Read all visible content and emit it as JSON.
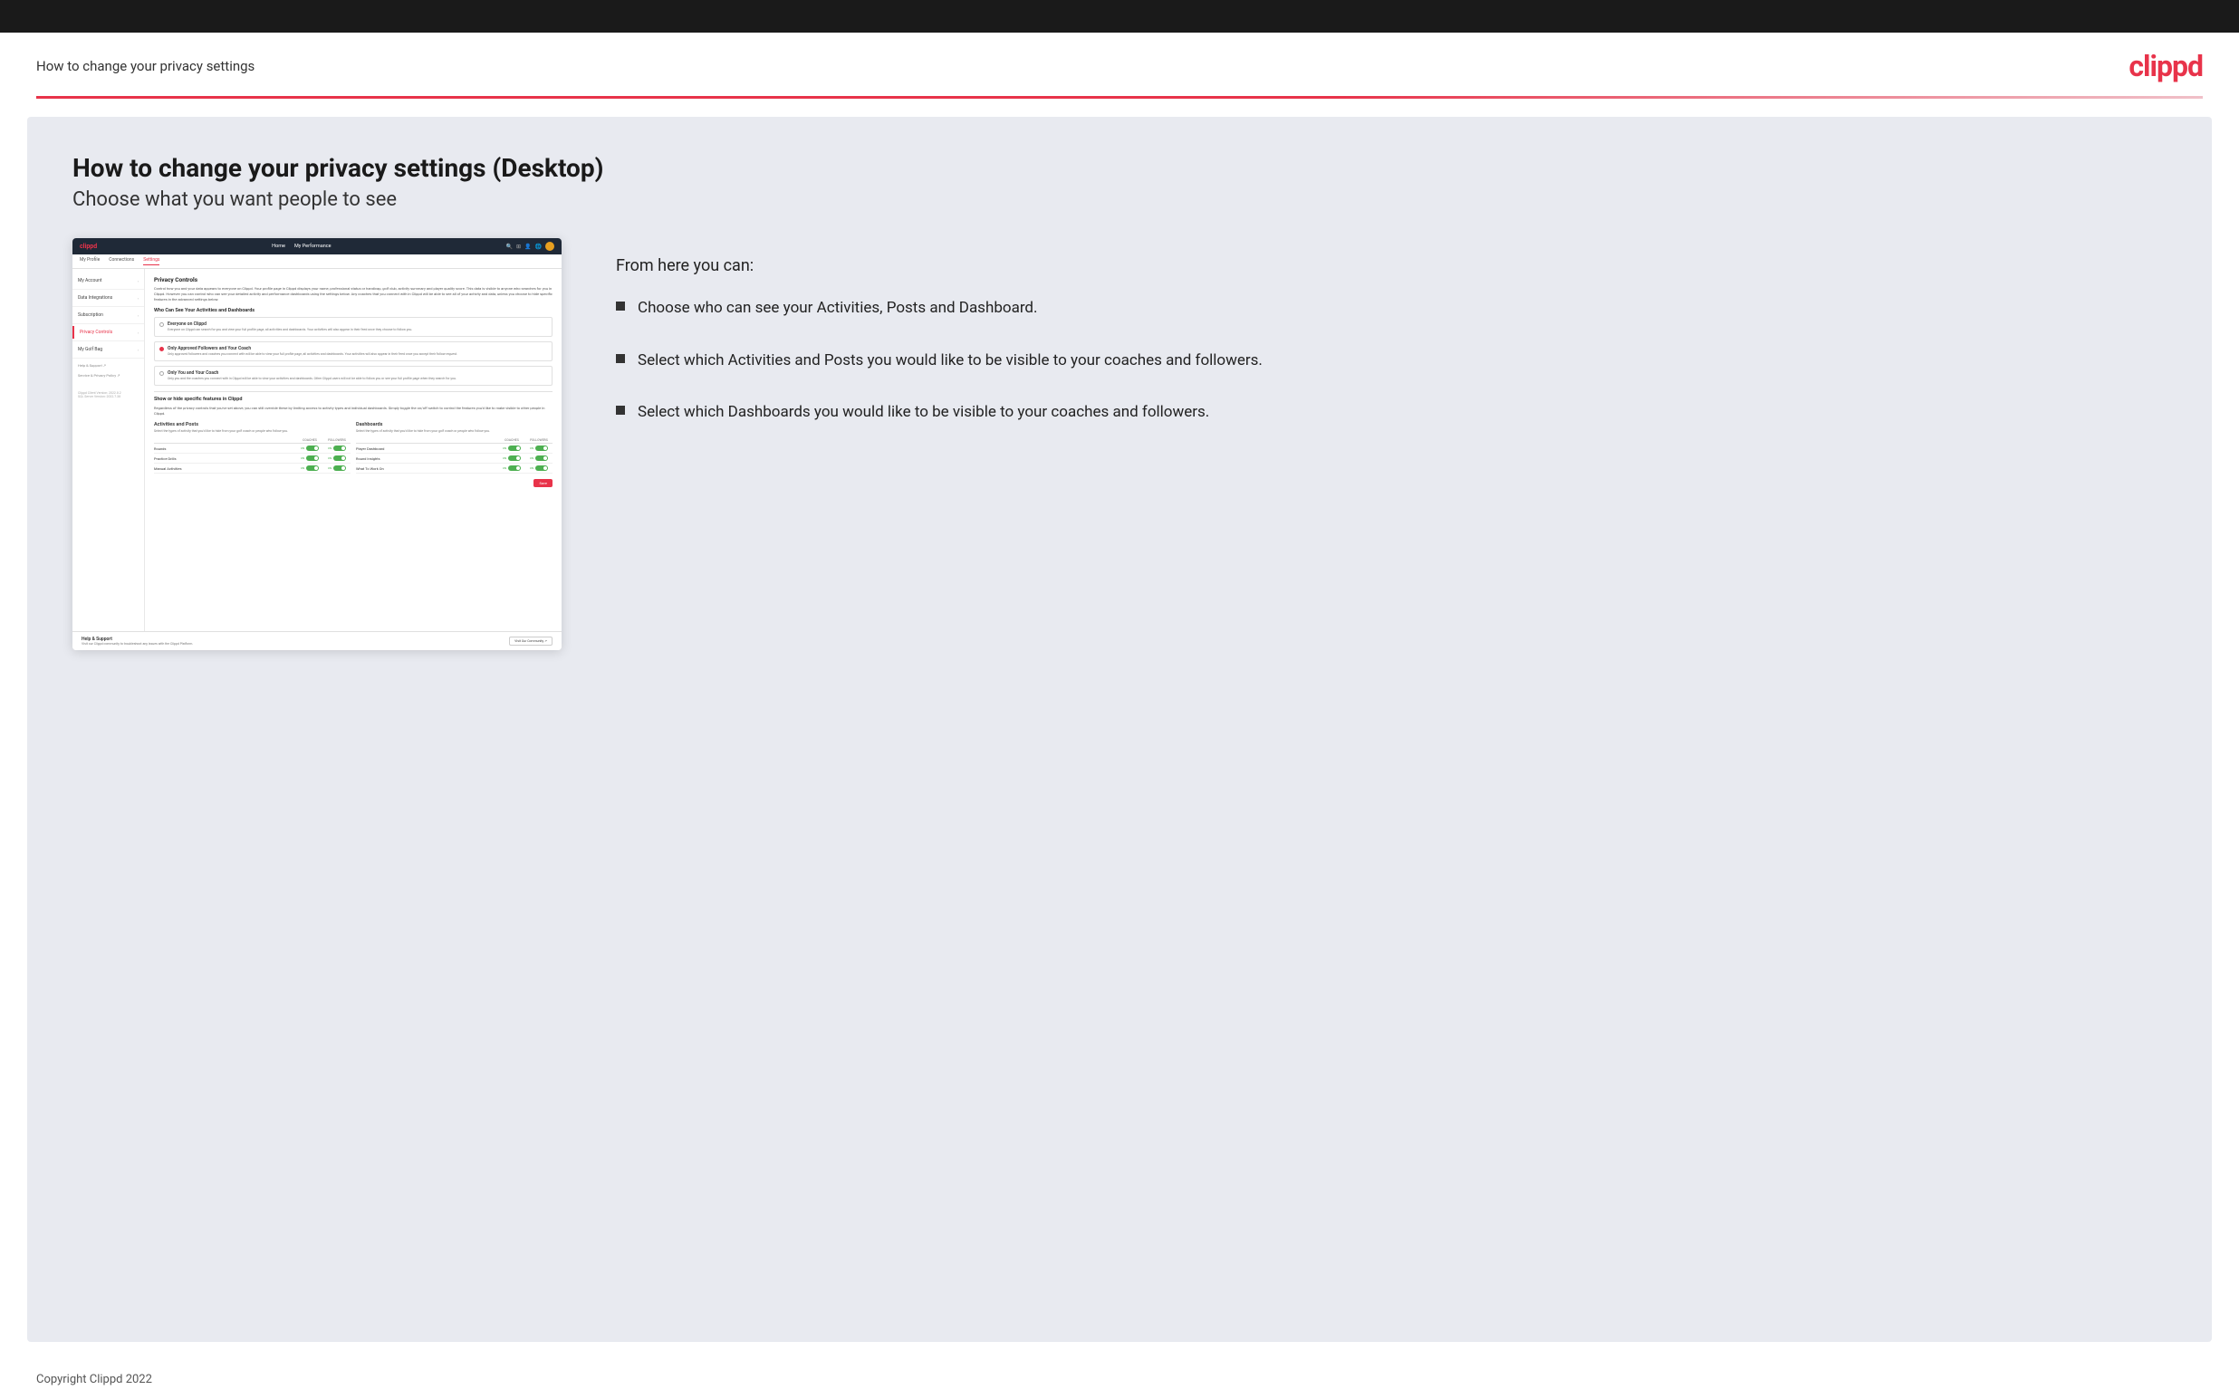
{
  "topBar": {},
  "header": {
    "title": "How to change your privacy settings",
    "logo": "clippd"
  },
  "main": {
    "heading": "How to change your privacy settings (Desktop)",
    "subheading": "Choose what you want people to see",
    "rightPanel": {
      "intro": "From here you can:",
      "bullets": [
        "Choose who can see your Activities, Posts and Dashboard.",
        "Select which Activities and Posts you would like to be visible to your coaches and followers.",
        "Select which Dashboards you would like to be visible to your coaches and followers."
      ]
    }
  },
  "mockup": {
    "nav": {
      "logo": "clippd",
      "links": [
        "Home",
        "My Performance"
      ],
      "icons": [
        "search",
        "grid",
        "person",
        "globe",
        "avatar"
      ]
    },
    "subnav": {
      "tabs": [
        "My Profile",
        "Connections",
        "Settings"
      ]
    },
    "sidebar": {
      "items": [
        {
          "label": "My Account",
          "active": false
        },
        {
          "label": "Data Integrations",
          "active": false
        },
        {
          "label": "Subscription",
          "active": false
        },
        {
          "label": "Privacy Controls",
          "active": true
        },
        {
          "label": "My Golf Bag",
          "active": false
        }
      ],
      "footerItems": [
        {
          "label": "Help & Support ↗"
        },
        {
          "label": "Service & Privacy Policy ↗"
        }
      ],
      "version": "Clippd Client Version: 2022.8.2\nSQL Server Version: 2022.7.38"
    },
    "mainPanel": {
      "sectionTitle": "Privacy Controls",
      "sectionDesc": "Control how you and your data appears to everyone on Clippd. Your profile page in Clippd displays your name, professional status or handicap, golf club, activity summary and player quality score. This data is visible to anyone who searches for you in Clippd. However you can control who can see your detailed activity and performance dashboards using the settings below. Any coaches that you connect with in Clippd will be able to see all of your activity and data, unless you choose to hide specific features in the advanced settings below.",
      "whoCanSeeTitle": "Who Can See Your Activities and Dashboards",
      "radioOptions": [
        {
          "label": "Everyone on Clippd",
          "desc": "Everyone on Clippd can search for you and view your full profile page, all activities and dashboards. Your activities will also appear in their feed once they choose to follow you.",
          "selected": false
        },
        {
          "label": "Only Approved Followers and Your Coach",
          "desc": "Only approved followers and coaches you connect with will be able to view your full profile page, all activities and dashboards. Your activities will also appear in their feed once you accept their follow request.",
          "selected": true
        },
        {
          "label": "Only You and Your Coach",
          "desc": "Only you and the coaches you connect with in Clippd will be able to view your activities and dashboards. Other Clippd users will not be able to follow you or see your full profile page when they search for you.",
          "selected": false
        }
      ],
      "showHideTitle": "Show or hide specific features in Clippd",
      "showHideDesc": "Regardless of the privacy controls that you've set above, you can still override these by limiting access to activity types and individual dashboards. Simply toggle the on/off switch to control the features you'd like to make visible to other people in Clippd.",
      "activitiesBlock": {
        "title": "Activities and Posts",
        "desc": "Select the types of activity that you'd like to hide from your golf coach or people who follow you.",
        "headers": [
          "COACHES",
          "FOLLOWERS"
        ],
        "rows": [
          {
            "label": "Rounds",
            "coachesOn": true,
            "followersOn": true
          },
          {
            "label": "Practice Drills",
            "coachesOn": true,
            "followersOn": true
          },
          {
            "label": "Manual Activities",
            "coachesOn": true,
            "followersOn": true
          }
        ]
      },
      "dashboardsBlock": {
        "title": "Dashboards",
        "desc": "Select the types of activity that you'd like to hide from your golf coach or people who follow you.",
        "headers": [
          "COACHES",
          "FOLLOWERS"
        ],
        "rows": [
          {
            "label": "Player Dashboard",
            "coachesOn": true,
            "followersOn": true
          },
          {
            "label": "Round Insights",
            "coachesOn": true,
            "followersOn": true
          },
          {
            "label": "What To Work On",
            "coachesOn": true,
            "followersOn": true
          }
        ]
      },
      "saveLabel": "Save"
    },
    "helpSection": {
      "title": "Help & Support",
      "desc": "Visit our Clippd community to troubleshoot any issues with the Clippd Platform.",
      "buttonLabel": "Visit Our Community ↗"
    }
  },
  "footer": {
    "text": "Copyright Clippd 2022"
  }
}
